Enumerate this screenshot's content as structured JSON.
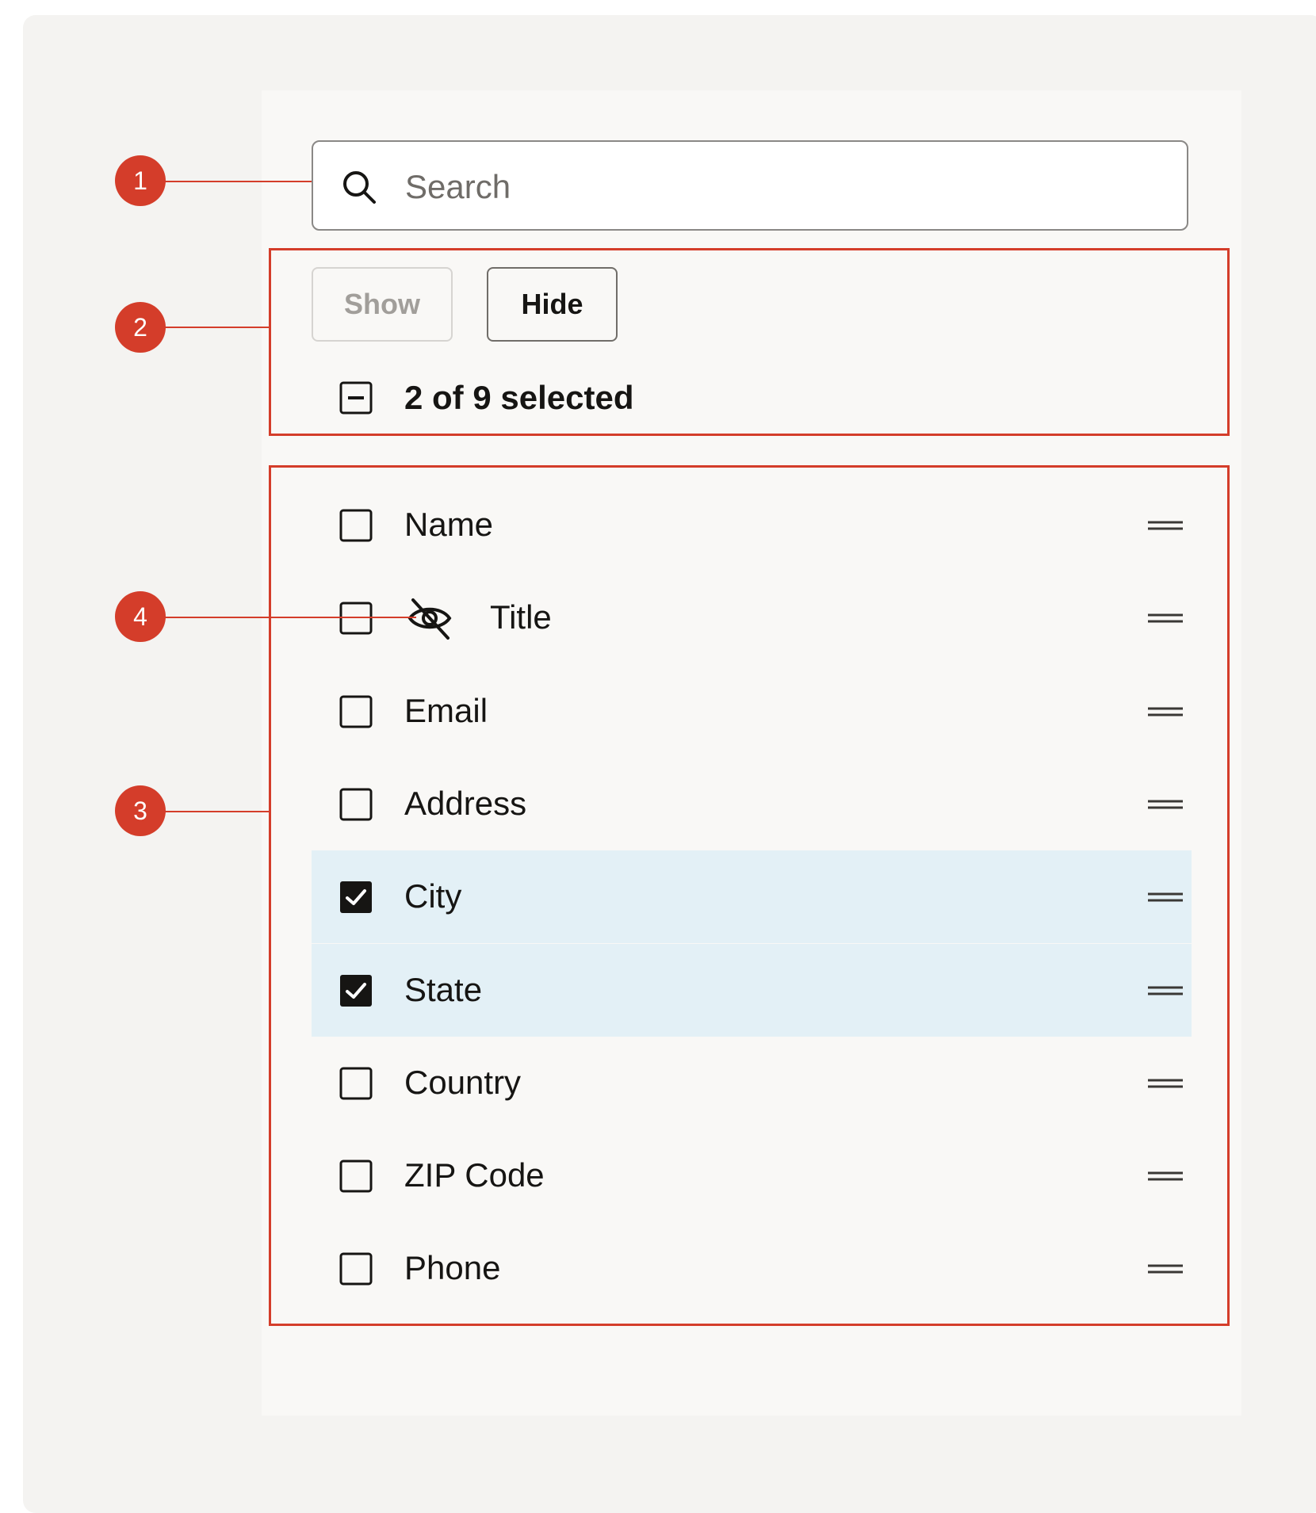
{
  "search": {
    "placeholder": "Search"
  },
  "actions": {
    "show_label": "Show",
    "hide_label": "Hide"
  },
  "selection": {
    "summary": "2 of 9 selected"
  },
  "columns": [
    {
      "label": "Name",
      "checked": false,
      "hidden": false
    },
    {
      "label": "Title",
      "checked": false,
      "hidden": true
    },
    {
      "label": "Email",
      "checked": false,
      "hidden": false
    },
    {
      "label": "Address",
      "checked": false,
      "hidden": false
    },
    {
      "label": "City",
      "checked": true,
      "hidden": false
    },
    {
      "label": "State",
      "checked": true,
      "hidden": false
    },
    {
      "label": "Country",
      "checked": false,
      "hidden": false
    },
    {
      "label": "ZIP Code",
      "checked": false,
      "hidden": false
    },
    {
      "label": "Phone",
      "checked": false,
      "hidden": false
    }
  ],
  "callouts": [
    "1",
    "2",
    "3",
    "4"
  ],
  "colors": {
    "callout": "#d43d2a",
    "selected_row": "#e3f0f6",
    "checkbox_checked": "#161513"
  },
  "icons": {
    "search": "search-icon",
    "hidden": "eye-slash-icon",
    "drag": "drag-handle-icon",
    "partial": "checkbox-indeterminate-icon"
  }
}
